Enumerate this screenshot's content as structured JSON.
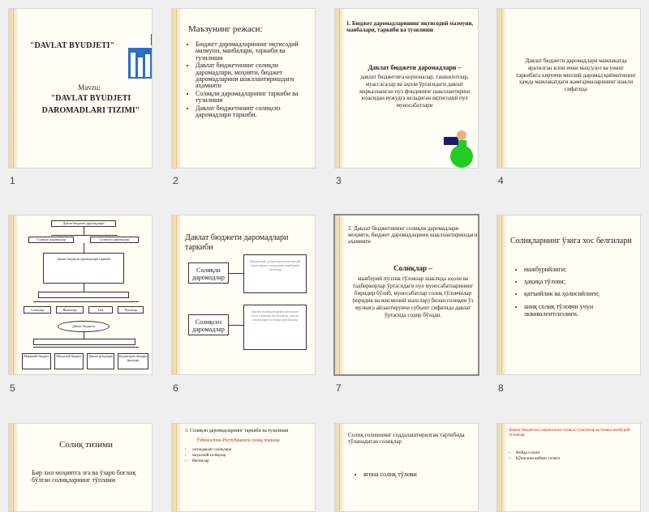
{
  "slides": [
    {
      "num": "1",
      "title": "\"DAVLAT BYUDJETI\"",
      "label": "Mavzu:",
      "subtitle": "\"DAVLAT BYUDJETI DAROMADLARI TIZIMI\""
    },
    {
      "num": "2",
      "title": "Маъзунинг режаси:",
      "items": [
        "Бюджет даромадларининг иқтисодий мазмуни, манбалари, таркиби ва тузилиши",
        "Давлат бюджетининг солиқли даромадлари, моҳияти, бюджет даромадларини шакллантиришдаги аҳамияти",
        "Солиқли даромадларнинг таркиби ва тузилиши",
        "Давлат бюджетининг солиқсиз даромадлари таркиби."
      ]
    },
    {
      "num": "3",
      "title": "1. Бюджет даромадларининг иқтисодий мазмуни, манбалари, таркиби ва тузилиши",
      "bold": "Давлат бюджети даромадлари –",
      "body": "давлат бюджетига корхоналар, ташкилотлар, муассасалар ва аҳоли ўртасидаги давлат марказлашган пул фондининг шакллантириш юзасидан вужудга келадиган иқтисодий пул муносабатлари"
    },
    {
      "num": "4",
      "text": "Давлат бюджети даромадлари мамлакатда яратилган ялпи ички маҳсулот ва унинг таркибига кирувчи миллий даромад қийматининг ҳамда мамлакатдаги жамғармаларининг шакли сифатида"
    },
    {
      "num": "5",
      "top": "Давлат бюджети даромадлари",
      "left": "Солиқли даромадлар",
      "right": "Солиқсиз даромадлар",
      "mid": "Давлат бюджети даромадлари таркиби",
      "b1": "Солиқлар",
      "b2": "Йиғимлар",
      "b3": "Бож",
      "b4": "Тўловлар",
      "oval": "Давлат бюджети",
      "f1": "Марказий бюджет",
      "f2": "Маҳаллий бюджет",
      "f3": "Давлат фондлари",
      "f4": "Бюджетдан ташқари фондлар"
    },
    {
      "num": "6",
      "title": "Давлат бюджети даромадлари таркиби",
      "box1": "Солиқли даромадлар",
      "box2": "Солиқсиз даромадлар",
      "desc1": "Иқтисодий субъектлар ва жисмоний шахслардан олинадиган мажбурий тўловлар",
      "desc2": "Давлат мулкидан фойдаланганлик учун олинадиган тўловлар, давлат хизматлари ва бошқа даромадлар"
    },
    {
      "num": "7",
      "title": "2. Давлат бюджетининг солиқли даромадлари моҳияти, бюджет даромадларини шакллантиришдаги аҳамияти",
      "bold": "Солиқлар –",
      "body": "мажбурий пуллик тўловлар шаклида аҳоли ва тадбиркорлар ўртасидаги пул муносабатларининг биридир бўлиб, муносабатлар солиқ тўловчилар (юридик ва жисмоний шахслар) билан солиқни ўз мулкига айлантирувчи субъект сифатида давлат ўртасида содир бўлади."
    },
    {
      "num": "8",
      "title": "Солиқларнинг ўзига хос белгилари",
      "items": [
        "мажбурийлиги;",
        "ҳақиқа тўлови;",
        "қатъийлик ва ҳолисийлиги;",
        "аниқ солиқ тўловчи учун эквивалентсизлиги."
      ]
    },
    {
      "title": "Солиқ тизими",
      "body": "Бир хил моҳиятга эга ва ўзаро боғлиқ бўлган солиқларнинг тўплами"
    },
    {
      "title": "3. Солиқли даромадларнинг таркиби ва тузилиши",
      "red": "Ўзбекистон Республикаси солиқ тизими",
      "items": [
        "умумдавлат солиқлари",
        "маҳаллий солиқлар",
        "йиғимлар"
      ]
    },
    {
      "title": "Солиқ солишнинг соддалаштирилган тартибида тўланадиган солиқлар",
      "items": [
        "ягона солиқ тўлови"
      ]
    },
    {
      "title": "Давлат бюджетига ажратилган солиқли тушумлар ва бошқа мажбурий тўловлар",
      "items": [
        "Фойда солиғи",
        "Қўшилган қиймат солиғи"
      ]
    }
  ]
}
